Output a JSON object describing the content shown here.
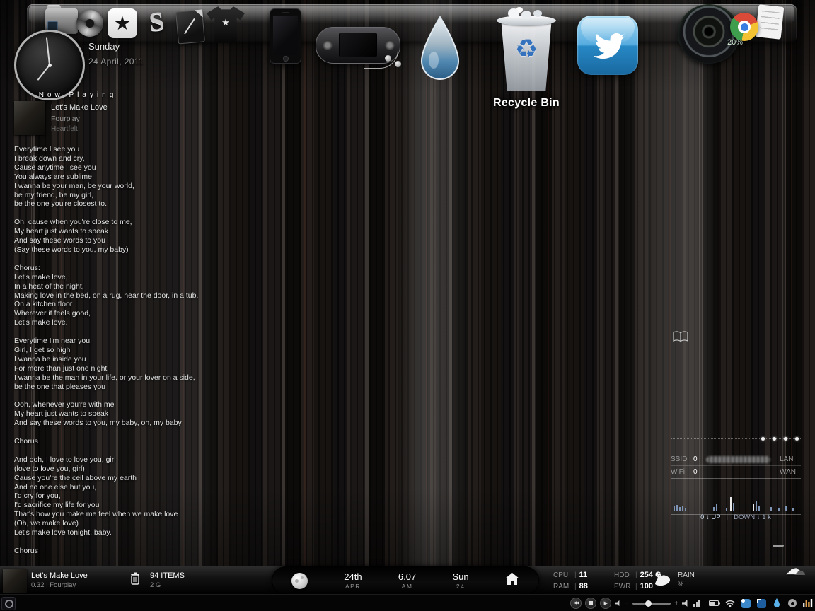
{
  "dock": {
    "icons": [
      "folder-icon",
      "media-swirl-icon",
      "star-app-icon",
      "winamp-icon",
      "notes-icon",
      "tshirt-app-icon",
      "iphone-icon",
      "psp-icon",
      "water-drop-icon",
      "recycle-bin-icon",
      "twitter-icon",
      "speaker-icon",
      "chrome-icon"
    ],
    "recycle_bin_label": "Recycle Bin",
    "speaker_level": "20%"
  },
  "calendar": {
    "weekday": "Sunday",
    "date": "24 April, 2011"
  },
  "now_playing": {
    "header": "Now Playing",
    "title": "Let's Make Love",
    "artist": "Fourplay",
    "album": "Heartfelt"
  },
  "lyrics": "Everytime I see you\nI break down and cry,\nCause anytime I see you\nYou always are sublime\nI wanna be your man, be your world,\nbe my friend, be my girl,\nbe the one you're closest to.\n\nOh, cause when you're close to me,\nMy heart just wants to speak\nAnd say these words to you\n(Say these words to you, my baby)\n\nChorus:\nLet's make love,\nIn a heat of the night,\nMaking love in the bed, on a rug, near the door, in a tub,\nOn a kitchen floor\nWherever it feels good,\nLet's make love.\n\nEverytime I'm near you,\nGirl, I get so high\nI wanna be inside you\nFor more than just one night\nI wanna be the man in your life, or your lover on a side,\nbe the one that pleases you\n\nOoh, whenever you're with me\nMy heart just wants to speak\nAnd say these words to you, my baby, oh, my baby\n\nChorus\n\nAnd ooh, I love to love you, girl\n(love to love you, girl)\nCause you're the ceil above my earth\nAnd no one else but you,\nI'd cry for you,\nI'd sacrifice my life for you\nThat's how you make me feel when we make love\n(Oh, we make love)\nLet's make love tonight, baby.\n\nChorus",
  "network_panel": {
    "rows": [
      {
        "label": "SSID",
        "value": "0",
        "side": "LAN"
      },
      {
        "label": "WiFi",
        "value": "0",
        "side": "WAN"
      }
    ],
    "traffic_up": "0 ↕ UP",
    "traffic_sep": "|",
    "traffic_down": "DOWN ↕ 1 k"
  },
  "bottom_bar": {
    "track_title": "Let's Make Love",
    "track_detail": "0.32 | Fourplay",
    "recycle_items": "94 ITEMS",
    "recycle_size": "2 G",
    "date_day": "24th",
    "date_month": "APR",
    "time": "6.07",
    "meridiem": "AM",
    "weekday": "Sun",
    "day_number": "24",
    "stat_sep": "|",
    "stats": [
      {
        "label": "CPU",
        "value": "11"
      },
      {
        "label": "RAM",
        "value": "88"
      },
      {
        "label": "HDD",
        "value": "254 G"
      },
      {
        "label": "PWR",
        "value": "100"
      }
    ],
    "rain_label": "RAIN",
    "rain_unit": "%"
  },
  "glyphs": {
    "star": "★",
    "app_s": "S",
    "tee_star": "★",
    "recycle": "♻",
    "cloud": "☁",
    "rewind": "◀◀",
    "play": "▶",
    "minus": "−",
    "plus": "+"
  },
  "colors": {
    "twitter_blue": "#2788c4",
    "recycle_blue": "#3472bd",
    "accent_orange": "#e2a24e"
  }
}
